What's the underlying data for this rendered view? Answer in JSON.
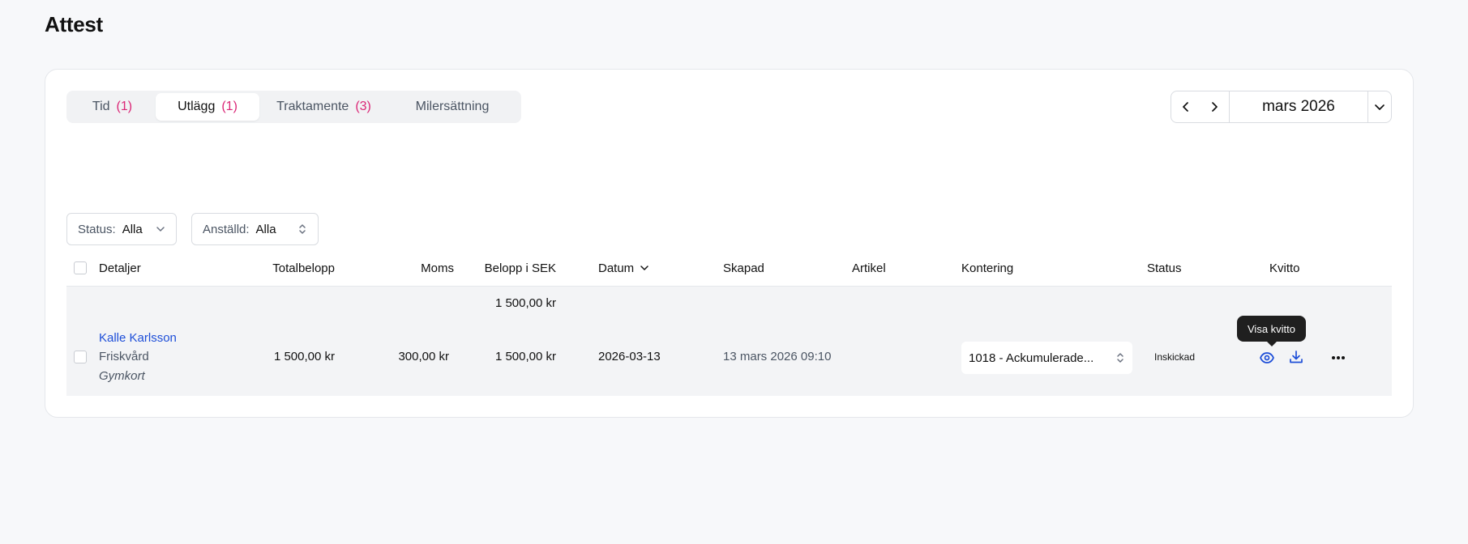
{
  "page": {
    "title": "Attest"
  },
  "tabs": [
    {
      "label": "Tid",
      "count": "(1)"
    },
    {
      "label": "Utlägg",
      "count": "(1)"
    },
    {
      "label": "Traktamente",
      "count": "(3)"
    },
    {
      "label": "Milersättning",
      "count": ""
    }
  ],
  "active_tab": "Utlägg",
  "month_picker": {
    "value": "mars 2026"
  },
  "filters": {
    "status": {
      "label": "Status:",
      "value": "Alla"
    },
    "employee": {
      "label": "Anställd:",
      "value": "Alla"
    }
  },
  "table": {
    "columns": [
      "Detaljer",
      "Totalbelopp",
      "Moms",
      "Belopp i SEK",
      "Datum",
      "Skapad",
      "Artikel",
      "Kontering",
      "Status",
      "Kvitto"
    ],
    "sort": {
      "column": "Datum",
      "direction": "descending"
    },
    "summary": {
      "belopp_sek": "1 500,00 kr"
    },
    "rows": [
      {
        "name": "Kalle Karlsson",
        "category": "Friskvård",
        "description": "Gymkort",
        "total": "1 500,00 kr",
        "vat": "300,00 kr",
        "amount_sek": "1 500,00 kr",
        "date": "2026-03-13",
        "created": "13 mars 2026 09:10",
        "article": "",
        "account": "1018 - Ackumulerade...",
        "status": "Inskickad"
      }
    ]
  },
  "tooltip": {
    "text": "Visa kvitto"
  },
  "icons": {
    "prev": "chevron-left-icon",
    "next": "chevron-right-icon",
    "dropdown": "chevron-down-icon",
    "select": "chevrons-up-down-icon",
    "view": "eye-icon",
    "download": "download-icon",
    "more": "more-horizontal-icon"
  },
  "colors": {
    "accent_link": "#1d4ed8",
    "count_pink": "#db2777",
    "background": "#f7f8fa"
  }
}
